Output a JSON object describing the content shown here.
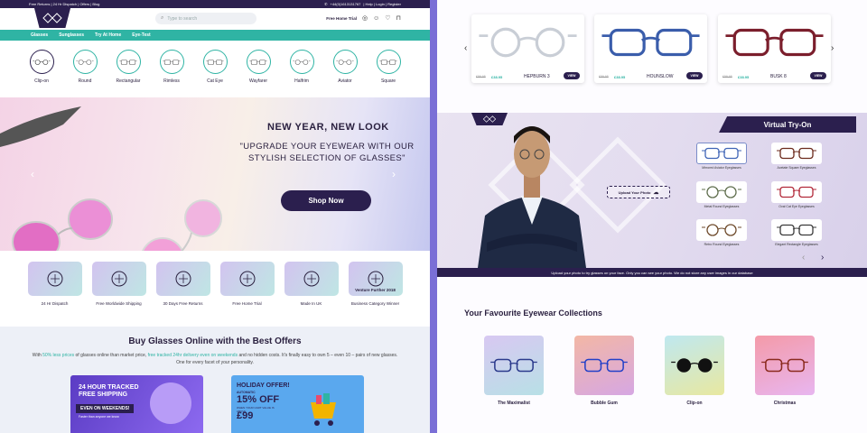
{
  "topbar": {
    "left": "Free Returns | 24 Hr Dispatch | Offers | Blog",
    "phone": "+44(0)1613131767",
    "links": "| Help | Login | Register"
  },
  "header": {
    "search_placeholder": "Type to search",
    "free_trial": "Free Home Trial"
  },
  "menu": [
    "Glasses",
    "Sunglasses",
    "Try At Home",
    "Eye-Test"
  ],
  "shapes": [
    {
      "label": "Clip-on",
      "icon": "clip-on-glasses-icon"
    },
    {
      "label": "Round",
      "icon": "round-glasses-icon"
    },
    {
      "label": "Rectangular",
      "icon": "rectangular-glasses-icon"
    },
    {
      "label": "Rimless",
      "icon": "rimless-glasses-icon"
    },
    {
      "label": "Cat Eye",
      "icon": "cat-eye-glasses-icon"
    },
    {
      "label": "Wayfarer",
      "icon": "wayfarer-glasses-icon"
    },
    {
      "label": "Halfrim",
      "icon": "halfrim-glasses-icon"
    },
    {
      "label": "Aviator",
      "icon": "aviator-glasses-icon"
    },
    {
      "label": "Square",
      "icon": "square-glasses-icon"
    }
  ],
  "hero": {
    "heading": "NEW YEAR, NEW LOOK",
    "subheading": "\"UPGRADE YOUR EYEWEAR WITH OUR STYLISH SELECTION OF GLASSES\"",
    "cta": "Shop Now"
  },
  "features": [
    {
      "label": "24 Hr Dispatch",
      "icon": "rocket-clock-icon"
    },
    {
      "label": "Free Worldwide Shipping",
      "icon": "delivery-truck-icon"
    },
    {
      "label": "30 Days Free Returns",
      "icon": "house-glasses-icon"
    },
    {
      "label": "Free Home Trial",
      "icon": "home-trial-icon"
    },
    {
      "label": "Made In UK",
      "icon": "uk-flag-icon"
    },
    {
      "label": "Business Category Winner",
      "badge": "Venture Further 2018",
      "icon": "bee-icon"
    }
  ],
  "buy": {
    "title": "Buy Glasses Online with the Best Offers",
    "p_1": "With ",
    "p_g1": "50% less prices",
    "p_2": " of glasses online than market price, ",
    "p_g2": "free tracked 24hr delivery even on weekends",
    "p_3": " and no hidden costs. It's finally easy to own 5 – even 10 – pairs of new glasses. One for every facet of your personality."
  },
  "promo1": {
    "line1": "24 HOUR TRACKED",
    "line2": "FREE SHIPPING",
    "band": "EVEN ON WEEKENDS!",
    "small": "Faster than anyone we know"
  },
  "promo2": {
    "title": "HOLIDAY OFFER!",
    "auto": "AUTOMATIC",
    "off": "15% OFF",
    "when": "WHEN YOUR CART VALUE IS ABOVE",
    "price": "£99"
  },
  "products": [
    {
      "old": "£59.95",
      "new": "£38.95",
      "name": "HEPBURN 3",
      "view": "VIEW",
      "color": "#c9ced6"
    },
    {
      "old": "£59.95",
      "new": "£38.95",
      "name": "HOUNSLOW",
      "view": "VIEW",
      "color": "#3a5dab"
    },
    {
      "old": "£59.95",
      "new": "£38.95",
      "name": "BUSK 8",
      "view": "VIEW",
      "color": "#7b1e2c"
    }
  ],
  "tryon": {
    "title": "Virtual Try-On",
    "upload": "Upload Your Photo",
    "footer": "Upload your photo to try glasses on your face. Only you can see your photo. We do not store any user images in our database",
    "items": [
      {
        "label": "Mirrored Aviator Eyeglasses",
        "color": "#3f64b6"
      },
      {
        "label": "Acetate Square Eyeglasses",
        "color": "#6b2a1c"
      },
      {
        "label": "Metal Round Eyeglasses",
        "color": "#5f6e4d"
      },
      {
        "label": "Oval Cat Eye Eyeglasses",
        "color": "#b22a3a"
      },
      {
        "label": "Retro Round Eyeglasses",
        "color": "#6e4a2b"
      },
      {
        "label": "Elegant Rectangle Eyeglasses",
        "color": "#3b3b3b"
      }
    ]
  },
  "favourites": {
    "title": "Your Favourite Eyewear Collections",
    "items": [
      {
        "label": "The Maximalist",
        "color": "#2b3a8c"
      },
      {
        "label": "Bubble Gum",
        "color": "#2340c8"
      },
      {
        "label": "Clip-on",
        "color": "#111111"
      },
      {
        "label": "Christmas",
        "color": "#8a2a1e"
      }
    ]
  }
}
